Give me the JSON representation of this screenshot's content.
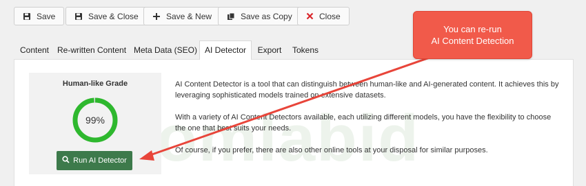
{
  "toolbar": {
    "buttons": [
      {
        "label": "Save",
        "icon": "save-icon"
      },
      {
        "label": "Save & Close",
        "icon": "save-icon"
      },
      {
        "label": "Save & New",
        "icon": "plus-icon"
      },
      {
        "label": "Save as Copy",
        "icon": "copy-icon"
      },
      {
        "label": "Close",
        "icon": "close-icon"
      }
    ]
  },
  "tabs": [
    {
      "label": "Content",
      "active": false
    },
    {
      "label": "Re-written Content",
      "active": false
    },
    {
      "label": "Meta Data (SEO)",
      "active": false
    },
    {
      "label": "AI Detector",
      "active": true
    },
    {
      "label": "Export",
      "active": false
    },
    {
      "label": "Tokens",
      "active": false
    }
  ],
  "detector": {
    "grade_title": "Human-like Grade",
    "grade_percent": 99,
    "grade_label": "99%",
    "run_button": "Run AI Detector",
    "ring_color": "#2eb82e"
  },
  "description": [
    "AI Content Detector is a tool that can distinguish between human-like and AI-generated content. It achieves this by leveraging sophisticated models trained on extensive datasets.",
    "With a variety of AI Content Detectors available, each utilizing different models, you have the flexibility to choose the one that best suits your needs.",
    "Of course, if you prefer, there are also other online tools at your disposal for similar purposes."
  ],
  "watermark": "Joomlabid",
  "annotation": {
    "text_line1": "You can re-run",
    "text_line2": "AI Content Detection",
    "color": "#f15a4a"
  }
}
